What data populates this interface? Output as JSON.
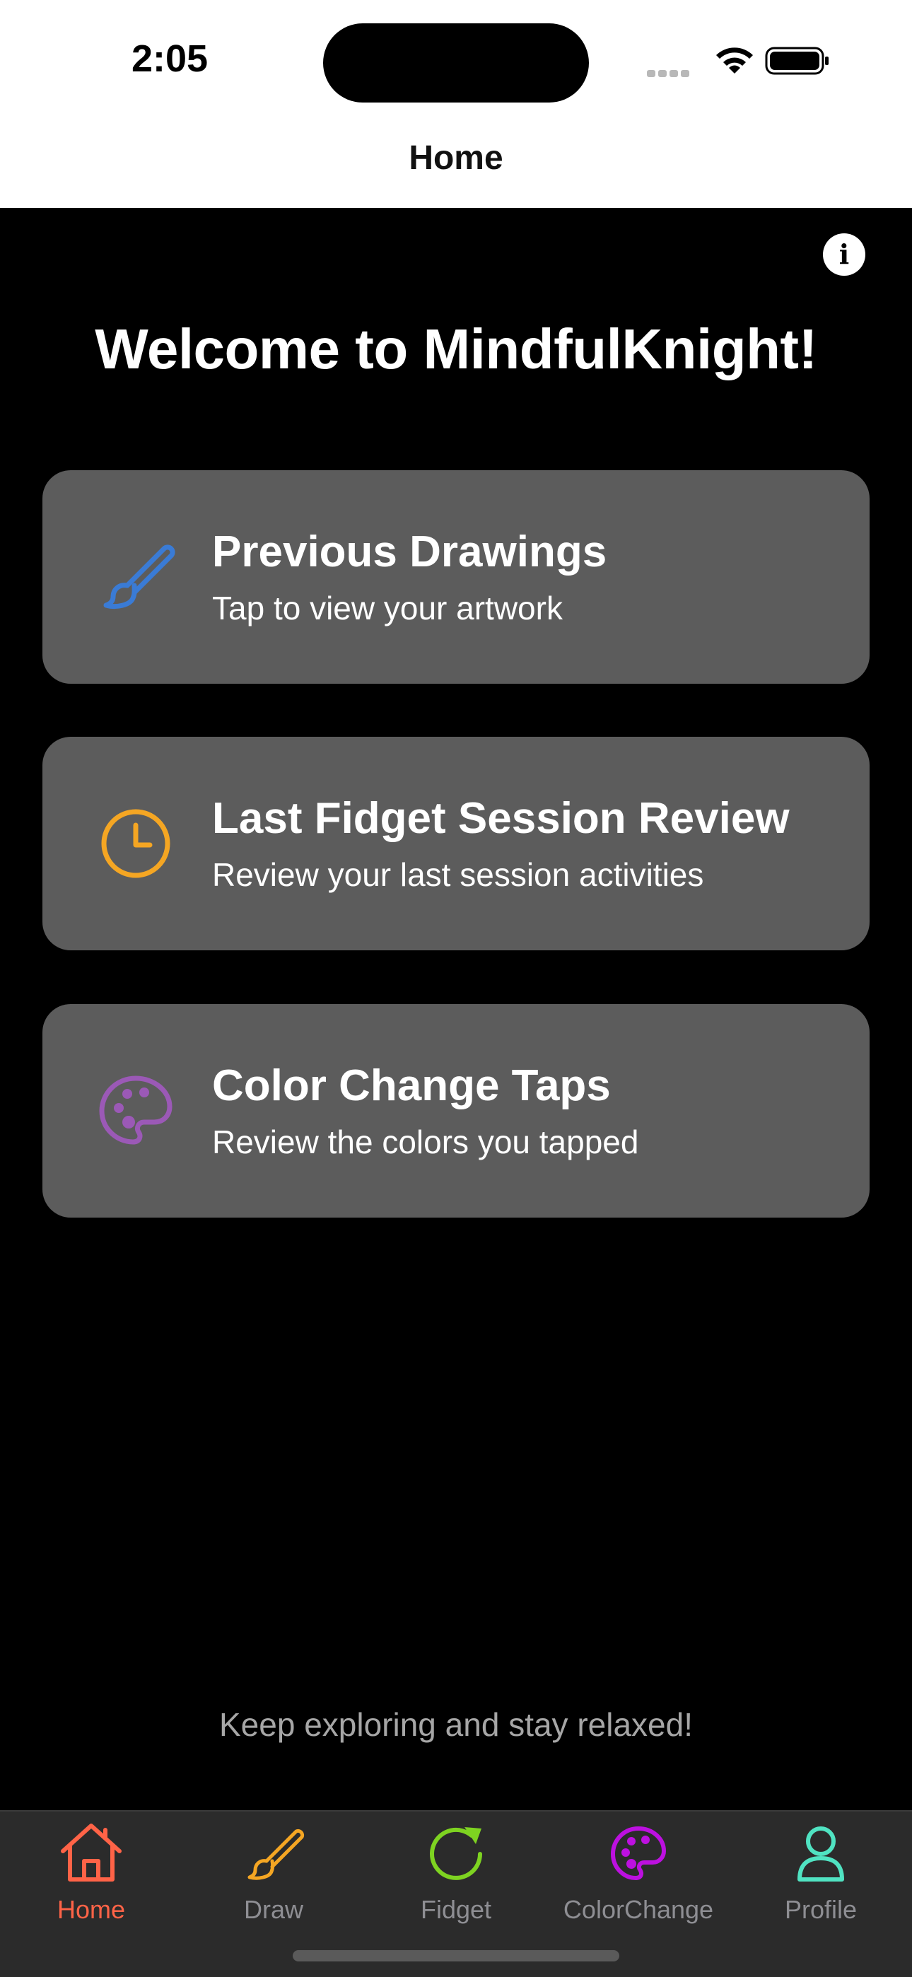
{
  "status_bar": {
    "time": "2:05"
  },
  "nav": {
    "title": "Home"
  },
  "welcome": "Welcome to MindfulKnight!",
  "info_icon": "info-icon",
  "cards": [
    {
      "title": "Previous Drawings",
      "subtitle": "Tap to view your artwork",
      "icon": "paintbrush-icon",
      "icon_color": "#3a7bd5"
    },
    {
      "title": "Last Fidget Session Review",
      "subtitle": "Review your last session activities",
      "icon": "clock-icon",
      "icon_color": "#f5a623"
    },
    {
      "title": "Color Change Taps",
      "subtitle": "Review the colors you tapped",
      "icon": "palette-icon",
      "icon_color": "#9b59b6"
    }
  ],
  "footer_note": "Keep exploring and stay relaxed!",
  "tabs": [
    {
      "label": "Home",
      "icon": "home-icon",
      "color": "#ff6347",
      "active": true
    },
    {
      "label": "Draw",
      "icon": "paintbrush-icon",
      "color": "#f5a623",
      "active": false
    },
    {
      "label": "Fidget",
      "icon": "refresh-icon",
      "color": "#7ed321",
      "active": false
    },
    {
      "label": "ColorChange",
      "icon": "palette-icon",
      "color": "#bd10e0",
      "active": false
    },
    {
      "label": "Profile",
      "icon": "person-icon",
      "color": "#50e3c2",
      "active": false
    }
  ]
}
